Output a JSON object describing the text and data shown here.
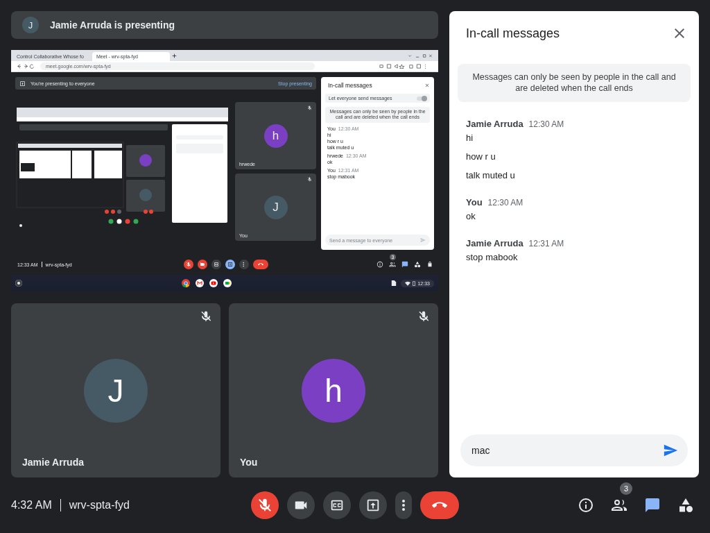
{
  "presenter_bar": {
    "avatar": "J",
    "text": "Jamie Arruda is presenting"
  },
  "shared_screen": {
    "browser_tabs": [
      {
        "title": "Control Collaborative Whose fo",
        "selected": false
      },
      {
        "title": "Meet - wrv-spta-fyd",
        "selected": true
      }
    ],
    "address": "meet.google.com/wrv-spta-fyd",
    "banner": {
      "text": "You're presenting to everyone",
      "action": "Stop presenting"
    },
    "tiles": [
      {
        "name": "hrwede",
        "avatar": "h",
        "color": "#7b3fc4",
        "muted": true
      },
      {
        "name": "You",
        "avatar": "J",
        "color": "#455a64",
        "muted": true
      }
    ],
    "chat": {
      "title": "In-call messages",
      "toggle_label": "Let everyone send messages",
      "toggle_on": true,
      "notice": "Messages can only be seen by people in the call and are deleted when the call ends",
      "messages": [
        {
          "sender": "You",
          "time": "12:30 AM",
          "lines": [
            "hi",
            "how r u",
            "talk muted u"
          ]
        },
        {
          "sender": "hrwede",
          "time": "12:30 AM",
          "lines": [
            "ok"
          ]
        },
        {
          "sender": "You",
          "time": "12:31 AM",
          "lines": [
            "stop mabook"
          ]
        }
      ],
      "placeholder": "Send a message to everyone"
    },
    "meeting_time": "12:33 AM",
    "meeting_code": "wrv-spta-fyd",
    "controls": [
      {
        "kind": "microphone",
        "off": true
      },
      {
        "kind": "camera",
        "off": true
      },
      {
        "kind": "captions"
      },
      {
        "kind": "present",
        "selected": true
      },
      {
        "kind": "more"
      },
      {
        "kind": "end-call"
      }
    ],
    "side_tools": [
      {
        "kind": "info",
        "selected": false
      },
      {
        "kind": "people",
        "badge": "3",
        "selected": false
      },
      {
        "kind": "chat",
        "selected": true
      },
      {
        "kind": "activities",
        "selected": false
      },
      {
        "kind": "host-controls",
        "selected": false
      }
    ],
    "shelf_time": "12:33"
  },
  "tiles": [
    {
      "name": "Jamie Arruda",
      "avatar": "J",
      "color": "#455a64",
      "muted": true
    },
    {
      "name": "You",
      "avatar": "h",
      "color": "#7b3fc4",
      "muted": true
    }
  ],
  "chat": {
    "title": "In-call messages",
    "notice": "Messages can only be seen by people in the call and are deleted when the call ends",
    "messages": [
      {
        "sender": "Jamie Arruda",
        "time": "12:30 AM",
        "lines": [
          "hi",
          "how r u",
          "talk muted u"
        ]
      },
      {
        "sender": "You",
        "time": "12:30 AM",
        "lines": [
          "ok"
        ]
      },
      {
        "sender": "Jamie Arruda",
        "time": "12:31 AM",
        "lines": [
          "stop mabook"
        ]
      }
    ],
    "input": "mac"
  },
  "bottom_bar": {
    "time": "4:32 AM",
    "meeting_code": "wrv-spta-fyd",
    "controls": [
      {
        "kind": "microphone",
        "off": true
      },
      {
        "kind": "camera",
        "off": false
      },
      {
        "kind": "captions"
      },
      {
        "kind": "present",
        "selected": false
      },
      {
        "kind": "more"
      },
      {
        "kind": "end-call"
      }
    ],
    "side_tools": [
      {
        "kind": "info",
        "selected": false
      },
      {
        "kind": "people",
        "badge": "3",
        "selected": false
      },
      {
        "kind": "chat",
        "selected": true
      },
      {
        "kind": "activities",
        "selected": false
      }
    ]
  }
}
